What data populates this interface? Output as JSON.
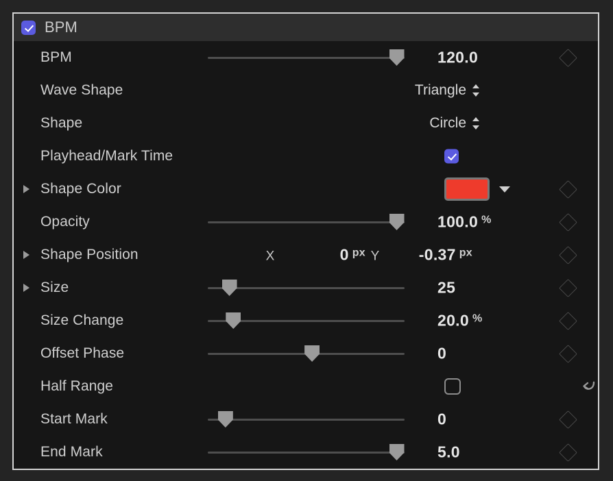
{
  "panel": {
    "group": {
      "title": "BPM",
      "enabled": true,
      "checkbox_icon": "checkbox-checked-icon"
    },
    "accent_color": "#5b5be0",
    "swatch_color": "#ee3b2c",
    "reset_icon": "undo-arrow-icon",
    "rows": [
      {
        "label": "BPM",
        "type": "slider",
        "value": "120.0",
        "unit": "",
        "slider_pct": 96,
        "disclosure": false,
        "keyframe": true
      },
      {
        "label": "Wave Shape",
        "type": "popup",
        "value": "Triangle",
        "unit": "",
        "disclosure": false,
        "keyframe": false
      },
      {
        "label": "Shape",
        "type": "popup",
        "value": "Circle",
        "unit": "",
        "disclosure": false,
        "keyframe": false
      },
      {
        "label": "Playhead/Mark Time",
        "type": "checkbox",
        "value": "",
        "checked": true,
        "disclosure": false,
        "keyframe": false
      },
      {
        "label": "Shape Color",
        "type": "color",
        "value": "#ee3b2c",
        "disclosure": true,
        "keyframe": true
      },
      {
        "label": "Opacity",
        "type": "slider",
        "value": "100.0",
        "unit": "%",
        "slider_pct": 96,
        "disclosure": false,
        "keyframe": true
      },
      {
        "label": "Shape Position",
        "type": "xy",
        "x_axis_label": "X",
        "x_value": "0",
        "x_unit": "px",
        "y_axis_label": "Y",
        "y_value": "-0.37",
        "y_unit": "px",
        "disclosure": true,
        "keyframe": true
      },
      {
        "label": "Size",
        "type": "slider",
        "value": "25",
        "unit": "",
        "slider_pct": 11,
        "disclosure": true,
        "keyframe": true
      },
      {
        "label": "Size Change",
        "type": "slider",
        "value": "20.0",
        "unit": "%",
        "slider_pct": 13,
        "disclosure": false,
        "keyframe": true
      },
      {
        "label": "Offset Phase",
        "type": "slider",
        "value": "0",
        "unit": "",
        "slider_pct": 53,
        "disclosure": false,
        "keyframe": true
      },
      {
        "label": "Half Range",
        "type": "checkbox",
        "value": "",
        "checked": false,
        "disclosure": false,
        "keyframe": false,
        "reset": true
      },
      {
        "label": "Start Mark",
        "type": "slider",
        "value": "0",
        "unit": "",
        "slider_pct": 9,
        "disclosure": false,
        "keyframe": true
      },
      {
        "label": "End Mark",
        "type": "slider",
        "value": "5.0",
        "unit": "",
        "slider_pct": 96,
        "disclosure": false,
        "keyframe": true
      }
    ]
  }
}
